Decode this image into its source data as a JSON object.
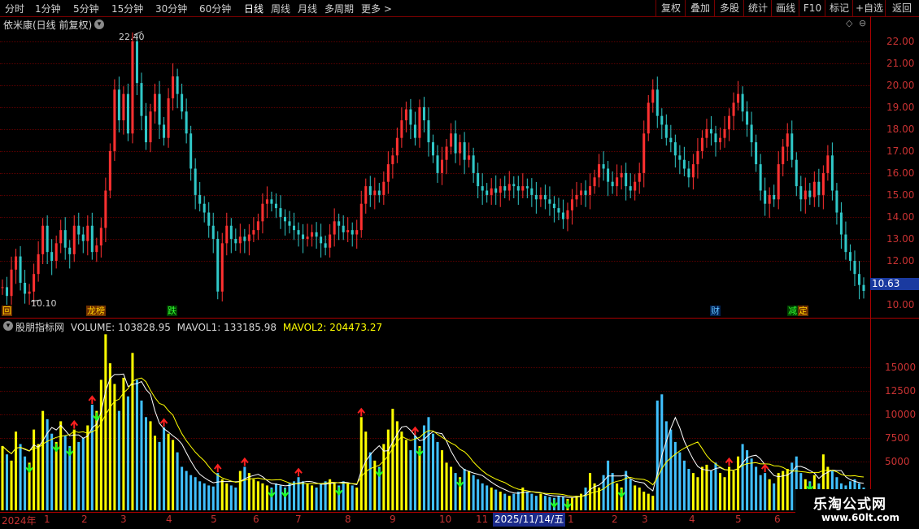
{
  "toolbar": {
    "periods": [
      {
        "label": "分时"
      },
      {
        "label": "1分钟"
      },
      {
        "label": "5分钟"
      },
      {
        "label": "15分钟"
      },
      {
        "label": "30分钟"
      },
      {
        "label": "60分钟"
      },
      {
        "label": "日线"
      },
      {
        "label": "周线"
      },
      {
        "label": "月线"
      },
      {
        "label": "多周期"
      },
      {
        "label": "更多 >"
      }
    ],
    "active_period": "日线",
    "right_buttons": [
      {
        "label": "复权"
      },
      {
        "label": "叠加"
      },
      {
        "label": "多股"
      },
      {
        "label": "统计"
      },
      {
        "label": "画线"
      },
      {
        "label": "F10"
      },
      {
        "label": "标记"
      },
      {
        "label": "+自选"
      },
      {
        "label": "返回"
      }
    ]
  },
  "chart_title": "依米康(日线 前复权)",
  "price_axis": {
    "labels": [
      "22.00",
      "21.00",
      "20.00",
      "19.00",
      "18.00",
      "17.00",
      "16.00",
      "15.00",
      "14.00",
      "13.00",
      "12.00",
      "10.00"
    ]
  },
  "current_price": "10.63",
  "annotations": {
    "high": "22.40",
    "low": "10.10"
  },
  "event_tags": [
    {
      "label": "回",
      "color": "#ffd000",
      "bg": "#703000"
    },
    {
      "label": "榜",
      "color": "#ffd000",
      "bg": "#703000",
      "prefix": "龙"
    },
    {
      "label": "跌",
      "color": "#30ff30",
      "bg": "#004000"
    },
    {
      "label": "财",
      "color": "#60c0ff",
      "bg": "#002050"
    },
    {
      "label": "减",
      "color": "#30ff30",
      "bg": "#004000"
    },
    {
      "label": "定",
      "color": "#ffd000",
      "bg": "#703000"
    }
  ],
  "indicator": {
    "name": "股朋指标网",
    "volume_label": "VOLUME: 103828.95",
    "mavol1_label": "MAVOL1: 133185.98",
    "mavol2_label": "MAVOL2: 204473.27"
  },
  "volume_axis": {
    "labels": [
      "15000",
      "12500",
      "10000",
      "7500",
      "5000"
    ]
  },
  "time_axis": {
    "labels": [
      "2024年",
      "1",
      "2",
      "3",
      "4",
      "5",
      "6",
      "7",
      "8",
      "9",
      "10",
      "11",
      "2025/11/14/五",
      "1",
      "2",
      "3",
      "4",
      "5",
      "6"
    ]
  },
  "watermark": {
    "text": "乐淘公式网",
    "url": "www.60lt.com"
  },
  "colors": {
    "up": "#ff3030",
    "down": "#30c8c8",
    "volume_up": "#ffff00",
    "volume_down": "#40c0ff",
    "mavol1": "#ffffff",
    "mavol2": "#ffff00",
    "grid": "#aa0000"
  },
  "chart_data": {
    "type": "candlestick",
    "title": "依米康(日线 前复权)",
    "price_range": [
      10.0,
      22.4
    ],
    "volume_range": [
      0,
      17500
    ],
    "high": 22.4,
    "low": 10.1,
    "last": 10.63,
    "price_series": [
      [
        10.8,
        10.4,
        11.6,
        12.2,
        11.0,
        10.5,
        10.6,
        11.4,
        12.3,
        13.6,
        12.4,
        12.0,
        12.8,
        13.4,
        12.6,
        12.3,
        13.6,
        13.2,
        12.9,
        13.6,
        12.4,
        12.7,
        13.5,
        15.2,
        17.0,
        19.8,
        18.4,
        19.6,
        17.8,
        22.0,
        20.1,
        18.6,
        17.4,
        18.8,
        19.6,
        18.2,
        17.6,
        19.4,
        20.4,
        19.6,
        18.8,
        17.8,
        16.2,
        15.0,
        14.6,
        14.2,
        13.6,
        13.0,
        10.6,
        12.8,
        13.6,
        13.0,
        12.8,
        13.1,
        12.9,
        13.2,
        13.4,
        13.8,
        14.6,
        14.8,
        14.6,
        14.4,
        14.0,
        13.8,
        13.6,
        13.4,
        13.2,
        13.0,
        13.1,
        13.3,
        13.1,
        12.8,
        12.6,
        13.2,
        13.8,
        13.6,
        13.3,
        13.4,
        13.2,
        13.4,
        14.6,
        15.4,
        15.0,
        15.2,
        15.0,
        15.6,
        16.4,
        16.8,
        17.6,
        18.4,
        18.9,
        18.2,
        17.6,
        19.0,
        18.4,
        17.4,
        16.8,
        16.0,
        16.6,
        17.2,
        17.8,
        16.9,
        17.4,
        16.6,
        16.8,
        16.0,
        15.4,
        15.2,
        15.0,
        15.3,
        15.1,
        15.4,
        15.2,
        15.5,
        15.4,
        15.2,
        15.4,
        15.3,
        15.0,
        14.8,
        15.0,
        14.8,
        14.6,
        14.4,
        14.2,
        13.9,
        14.3,
        14.8,
        15.0,
        15.2,
        15.0,
        15.4,
        15.8,
        16.4,
        16.2,
        15.6,
        15.4,
        15.8,
        16.0,
        15.4,
        15.2,
        15.6,
        16.0,
        17.8,
        19.2,
        19.8,
        18.6,
        18.2,
        17.6,
        17.4,
        16.8,
        16.6,
        16.2,
        15.8,
        16.4,
        17.0,
        17.6,
        18.0,
        17.8,
        17.4,
        17.6,
        18.0,
        18.6,
        19.2,
        19.6,
        18.8,
        18.2,
        17.4,
        16.4,
        15.2,
        14.6,
        15.0,
        14.8,
        16.4,
        17.2,
        17.8,
        16.6,
        15.4,
        14.8,
        15.2,
        14.9,
        15.6,
        15.0,
        16.0,
        16.8,
        15.2,
        14.2,
        13.2,
        12.4,
        12.0,
        11.4,
        10.9,
        10.63
      ]
    ],
    "volume_series": [
      [
        6200,
        5400,
        4800,
        7600,
        6400,
        5200,
        4600,
        7800,
        6400,
        9600,
        8800,
        7400,
        6600,
        8600,
        7200,
        6200,
        7800,
        6600,
        7000,
        8200,
        10200,
        9600,
        12600,
        17000,
        14200,
        12200,
        9600,
        12800,
        11000,
        15200,
        12600,
        10600,
        9000,
        8600,
        7200,
        6600,
        8000,
        7400,
        6800,
        5600,
        4200,
        3800,
        3400,
        3200,
        2800,
        2600,
        2400,
        2300,
        3600,
        3000,
        2600,
        2400,
        2200,
        3800,
        4200,
        3600,
        3000,
        2800,
        2600,
        2400,
        2200,
        2600,
        2400,
        2200,
        2600,
        2800,
        3200,
        2800,
        2600,
        2400,
        2200,
        2600,
        2800,
        3000,
        2600,
        2400,
        2800,
        2600,
        2400,
        2200,
        9000,
        7600,
        5600,
        4800,
        4200,
        6400,
        7800,
        9800,
        8600,
        7600,
        6800,
        5800,
        7200,
        6200,
        8200,
        9000,
        7400,
        6600,
        5800,
        4600,
        4200,
        3600,
        3200,
        4000,
        3800,
        3400,
        3000,
        2600,
        2400,
        2200,
        2000,
        1800,
        1600,
        1400,
        1600,
        1800,
        2200,
        1800,
        1600,
        1400,
        1600,
        1400,
        1300,
        1200,
        1400,
        1300,
        1100,
        1200,
        1400,
        1600,
        2200,
        3600,
        2600,
        2200,
        3400,
        4800,
        3600,
        2600,
        2200,
        3800,
        3000,
        2400,
        2200,
        1800,
        1600,
        1400,
        10600,
        11200,
        8600,
        7800,
        6600,
        5600,
        4800,
        4000,
        3600,
        3200,
        4200,
        4400,
        3800,
        4600,
        3600,
        3200,
        4200,
        3800,
        5200,
        6400,
        5800,
        5000,
        4200,
        3400,
        3600,
        3000,
        2600,
        3600,
        3800,
        4000,
        4600,
        5200,
        3600,
        3000,
        2800,
        3400,
        2600,
        5400,
        4200,
        3800,
        3200,
        2600,
        2400,
        2800,
        3000,
        2600,
        2200
      ]
    ]
  }
}
